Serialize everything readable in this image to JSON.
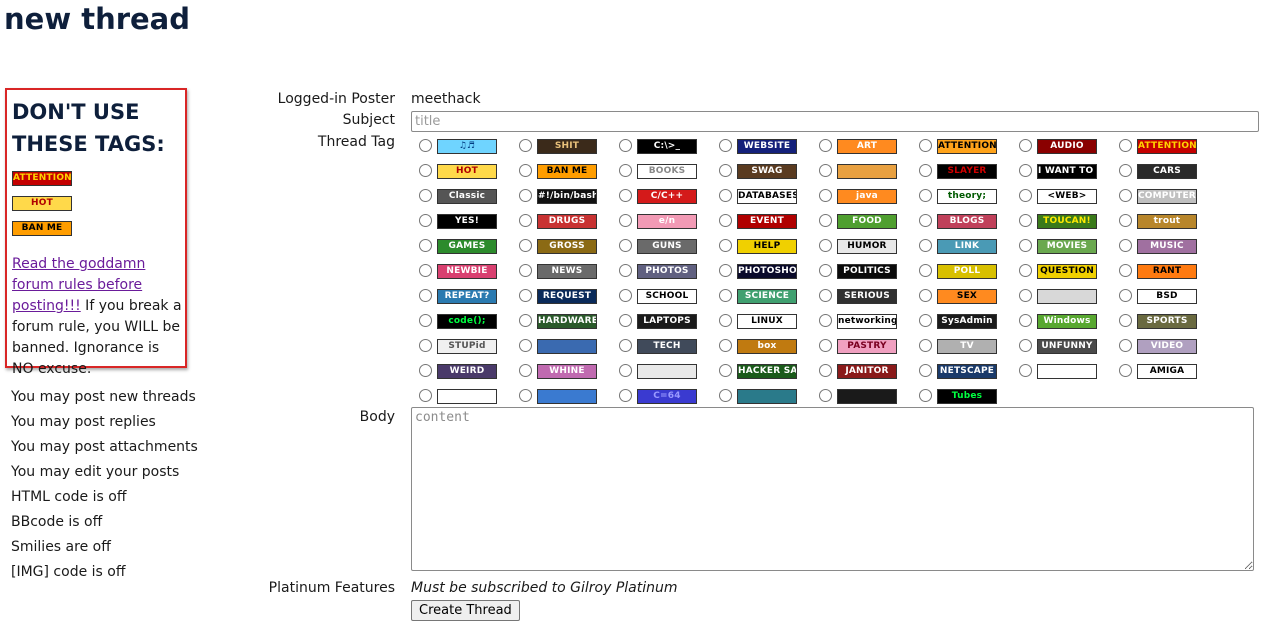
{
  "page": {
    "title": "new thread"
  },
  "warning": {
    "heading": "DON'T USE THESE TAGS:",
    "tags": [
      {
        "name": "attention",
        "label": "ATTENTION",
        "bg": "#c40000",
        "fg": "#ffd400"
      },
      {
        "name": "hot",
        "label": "HOT",
        "bg": "#ffd94a",
        "fg": "#b00000"
      },
      {
        "name": "ban-me",
        "label": "BAN ME",
        "bg": "#ff9d00",
        "fg": "#000000"
      }
    ],
    "link_text": "Read the goddamn forum rules before posting!!!",
    "message": " If you break a forum rule, you WILL be banned. Ignorance is NO excuse."
  },
  "permissions": [
    "You may post new threads",
    "You may post replies",
    "You may post attachments",
    "You may edit your posts",
    "HTML code is off",
    "BBcode is off",
    "Smilies are off",
    "[IMG] code is off"
  ],
  "form": {
    "poster_label": "Logged-in Poster",
    "poster_value": "meethack",
    "subject_label": "Subject",
    "subject_placeholder": "title",
    "tag_label": "Thread Tag",
    "body_label": "Body",
    "body_placeholder": "content",
    "platinum_label": "Platinum Features",
    "platinum_note": "Must be subscribed to Gilroy Platinum",
    "submit_label": "Create Thread"
  },
  "thread_tags": [
    {
      "label": "♫♬",
      "bg": "#6fd4ff",
      "fg": "#003a80"
    },
    {
      "label": "SHIT",
      "bg": "#3b2a1a",
      "fg": "#e8c07a"
    },
    {
      "label": "C:\\>_",
      "bg": "#000000",
      "fg": "#ffffff"
    },
    {
      "label": "WEBSITE",
      "bg": "#14207a",
      "fg": "#ffffff"
    },
    {
      "label": "ART",
      "bg": "#ff8a1f",
      "fg": "#ffffff"
    },
    {
      "label": "ATTENTION",
      "bg": "#ffa31a",
      "fg": "#000000"
    },
    {
      "label": "AUDIO",
      "bg": "#8a0000",
      "fg": "#ffffff"
    },
    {
      "label": "ATTENTION",
      "bg": "#c40000",
      "fg": "#ffd400"
    },
    {
      "label": "HOT",
      "bg": "#ffd94a",
      "fg": "#b00000"
    },
    {
      "label": "BAN ME",
      "bg": "#ff9d00",
      "fg": "#000000"
    },
    {
      "label": "BOOKS",
      "bg": "#ffffff",
      "fg": "#888888"
    },
    {
      "label": "SWAG",
      "bg": "#5a3b20",
      "fg": "#ffffff"
    },
    {
      "label": "",
      "bg": "#e8a040",
      "fg": "#ffffff"
    },
    {
      "label": "SLAYER",
      "bg": "#000000",
      "fg": "#d00000"
    },
    {
      "label": "I WANT TO BELIEVE",
      "bg": "#000000",
      "fg": "#ffffff"
    },
    {
      "label": "CARS",
      "bg": "#2a2a2a",
      "fg": "#ffffff"
    },
    {
      "label": "Classic",
      "bg": "#555555",
      "fg": "#ffffff"
    },
    {
      "label": "#!/bin/bash",
      "bg": "#111111",
      "fg": "#ffffff"
    },
    {
      "label": "C/C++",
      "bg": "#d41a1a",
      "fg": "#ffffff"
    },
    {
      "label": "DATABASES",
      "bg": "#ffffff",
      "fg": "#000000"
    },
    {
      "label": "java",
      "bg": "#ff8a1f",
      "fg": "#ffffff"
    },
    {
      "label": "theory;",
      "bg": "#ffffff",
      "fg": "#005a00"
    },
    {
      "label": "<WEB>",
      "bg": "#ffffff",
      "fg": "#000000"
    },
    {
      "label": "COMPUTERS",
      "bg": "#c0c0c0",
      "fg": "#ffffff"
    },
    {
      "label": "YES!",
      "bg": "#000000",
      "fg": "#ffffff"
    },
    {
      "label": "DRUGS",
      "bg": "#c83232",
      "fg": "#ffffff"
    },
    {
      "label": "e/n",
      "bg": "#f29ab5",
      "fg": "#ffffff"
    },
    {
      "label": "EVENT",
      "bg": "#b00000",
      "fg": "#ffffff"
    },
    {
      "label": "FOOD",
      "bg": "#4f9f2f",
      "fg": "#ffffff"
    },
    {
      "label": "BLOGS",
      "bg": "#c0405a",
      "fg": "#ffffff"
    },
    {
      "label": "TOUCAN!",
      "bg": "#3a7a1a",
      "fg": "#ffea00"
    },
    {
      "label": "trout",
      "bg": "#b8862b",
      "fg": "#ffffff"
    },
    {
      "label": "GAMES",
      "bg": "#2c8b2c",
      "fg": "#ffffff"
    },
    {
      "label": "GROSS",
      "bg": "#8b6a14",
      "fg": "#ffffff"
    },
    {
      "label": "GUNS",
      "bg": "#6a6a6a",
      "fg": "#ffffff"
    },
    {
      "label": "HELP",
      "bg": "#f0d000",
      "fg": "#000000"
    },
    {
      "label": "HUMOR",
      "bg": "#e8e8e8",
      "fg": "#000000"
    },
    {
      "label": "LINK",
      "bg": "#4a9ab5",
      "fg": "#ffffff"
    },
    {
      "label": "MOVIES",
      "bg": "#6aa84f",
      "fg": "#ffffff"
    },
    {
      "label": "MUSIC",
      "bg": "#a070a0",
      "fg": "#ffffff"
    },
    {
      "label": "NEWBIE",
      "bg": "#d94070",
      "fg": "#ffffff"
    },
    {
      "label": "NEWS",
      "bg": "#6a6a6a",
      "fg": "#ffffff"
    },
    {
      "label": "PHOTOS",
      "bg": "#606080",
      "fg": "#ffffff"
    },
    {
      "label": "PHOTOSHOP",
      "bg": "#0a0a2a",
      "fg": "#ffffff"
    },
    {
      "label": "POLITICS",
      "bg": "#0a0a0a",
      "fg": "#ffffff"
    },
    {
      "label": "POLL",
      "bg": "#d8c000",
      "fg": "#ffffff"
    },
    {
      "label": "QUESTION",
      "bg": "#f0d000",
      "fg": "#000000"
    },
    {
      "label": "RANT",
      "bg": "#ff7a10",
      "fg": "#000000"
    },
    {
      "label": "REPEAT?",
      "bg": "#2a7ab0",
      "fg": "#ffffff"
    },
    {
      "label": "REQUEST",
      "bg": "#0a2a5a",
      "fg": "#ffffff"
    },
    {
      "label": "SCHOOL",
      "bg": "#ffffff",
      "fg": "#000000"
    },
    {
      "label": "SCIENCE",
      "bg": "#40a070",
      "fg": "#ffffff"
    },
    {
      "label": "SERIOUS",
      "bg": "#303030",
      "fg": "#ffffff"
    },
    {
      "label": "SEX",
      "bg": "#ff8a1f",
      "fg": "#000000"
    },
    {
      "label": "",
      "bg": "#d8d8d8",
      "fg": "#000000"
    },
    {
      "label": "BSD",
      "bg": "#ffffff",
      "fg": "#000000"
    },
    {
      "label": "code();",
      "bg": "#000000",
      "fg": "#00ff40"
    },
    {
      "label": "HARDWARE",
      "bg": "#2a5a2a",
      "fg": "#ffffff"
    },
    {
      "label": "LAPTOPS",
      "bg": "#1a1a1a",
      "fg": "#ffffff"
    },
    {
      "label": "LINUX",
      "bg": "#ffffff",
      "fg": "#000000"
    },
    {
      "label": "networking",
      "bg": "#ffffff",
      "fg": "#000000"
    },
    {
      "label": "SysAdmin",
      "bg": "#1a1a1a",
      "fg": "#ffffff"
    },
    {
      "label": "Windows",
      "bg": "#58a830",
      "fg": "#ffffff"
    },
    {
      "label": "SPORTS",
      "bg": "#6a6a40",
      "fg": "#ffffff"
    },
    {
      "label": "STUPid",
      "bg": "#f0f0f0",
      "fg": "#555555"
    },
    {
      "label": "",
      "bg": "#3a6ab0",
      "fg": "#ffffff"
    },
    {
      "label": "TECH",
      "bg": "#404a5a",
      "fg": "#ffffff"
    },
    {
      "label": "box",
      "bg": "#c07a10",
      "fg": "#ffffff"
    },
    {
      "label": "PASTRY",
      "bg": "#f0a0c0",
      "fg": "#7a0020"
    },
    {
      "label": "TV",
      "bg": "#b0b0b0",
      "fg": "#ffffff"
    },
    {
      "label": "UNFUNNY",
      "bg": "#4a4a4a",
      "fg": "#ffffff"
    },
    {
      "label": "VIDEO",
      "bg": "#b0a0c0",
      "fg": "#ffffff"
    },
    {
      "label": "WEIRD",
      "bg": "#4a3a6a",
      "fg": "#ffffff"
    },
    {
      "label": "WHINE",
      "bg": "#c06ab0",
      "fg": "#ffffff"
    },
    {
      "label": "",
      "bg": "#e8e8e8",
      "fg": "#555555"
    },
    {
      "label": "HACKER SAFE",
      "bg": "#1a5a1a",
      "fg": "#ffffff"
    },
    {
      "label": "JANITOR",
      "bg": "#8a1a1a",
      "fg": "#ffffff"
    },
    {
      "label": "NETSCAPE",
      "bg": "#1a3a6a",
      "fg": "#ffffff"
    },
    {
      "label": "",
      "bg": "#ffffff",
      "fg": "#000000"
    },
    {
      "label": "AMIGA",
      "bg": "#ffffff",
      "fg": "#000000"
    },
    {
      "label": "",
      "bg": "#ffffff",
      "fg": "#1a5aa0"
    },
    {
      "label": "",
      "bg": "#3a7ad0",
      "fg": "#ffffff"
    },
    {
      "label": "C=64",
      "bg": "#3a3ad0",
      "fg": "#9a9aff"
    },
    {
      "label": "",
      "bg": "#2a7a8a",
      "fg": "#ffffff"
    },
    {
      "label": "",
      "bg": "#1a1a1a",
      "fg": "#888888"
    },
    {
      "label": "Tubes",
      "bg": "#000000",
      "fg": "#00ff40"
    }
  ]
}
